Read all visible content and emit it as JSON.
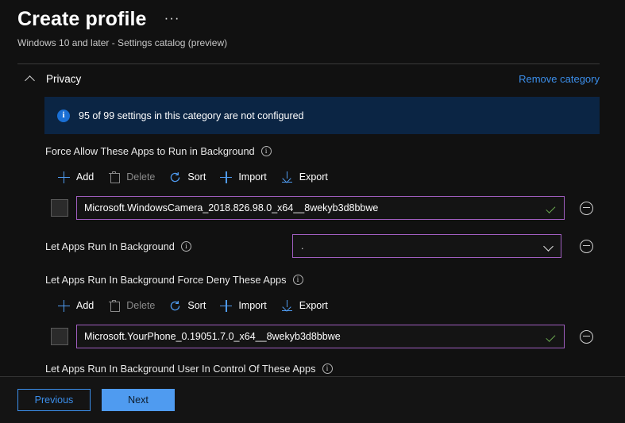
{
  "header": {
    "title": "Create profile",
    "more_menu": "···",
    "subtitle": "Windows 10 and later - Settings catalog (preview)"
  },
  "category": {
    "collapse_icon": "chevron-up",
    "name": "Privacy",
    "remove_link": "Remove category"
  },
  "banner": {
    "icon": "i",
    "text": "95 of 99 settings in this category are not configured",
    "background": "#0b2544"
  },
  "toolbar": {
    "add": "Add",
    "delete": "Delete",
    "sort": "Sort",
    "import": "Import",
    "export": "Export"
  },
  "settings": [
    {
      "label": "Force Allow These Apps to Run in Background",
      "type": "list",
      "value": "Microsoft.WindowsCamera_2018.826.98.0_x64__8wekyb3d8bbwe",
      "valid": true
    },
    {
      "label": "Let Apps Run In Background",
      "type": "dropdown",
      "value": "."
    },
    {
      "label": "Let Apps Run In Background Force Deny These Apps",
      "type": "list",
      "value": "Microsoft.YourPhone_0.19051.7.0_x64__8wekyb3d8bbwe",
      "valid": true
    },
    {
      "label": "Let Apps Run In Background User In Control Of These Apps",
      "type": "label-only"
    }
  ],
  "footer": {
    "previous": "Previous",
    "next": "Next"
  },
  "colors": {
    "accent_blue": "#4f9bf0",
    "link_blue": "#3b8eea",
    "input_border_purple": "#a05ec0",
    "valid_green": "#6aa84f",
    "banner_blue": "#0b2544",
    "page_background": "#111111"
  }
}
